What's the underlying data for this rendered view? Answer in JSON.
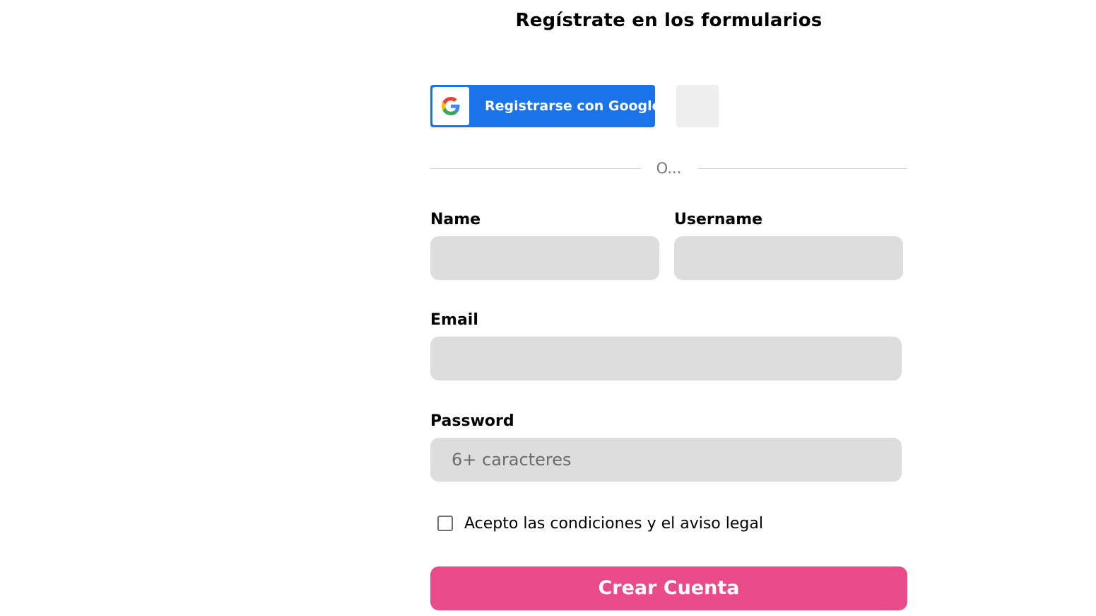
{
  "title": "Regístrate en los formularios",
  "social": {
    "google_label": "Registrarse con Google",
    "google_color": "#1a73e8",
    "google_icon": "google-g-icon"
  },
  "divider_text": "O...",
  "form": {
    "name_label": "Name",
    "name_value": "",
    "name_placeholder": "",
    "username_label": "Username",
    "username_value": "",
    "username_placeholder": "",
    "email_label": "Email",
    "email_value": "",
    "email_placeholder": "",
    "password_label": "Password",
    "password_value": "",
    "password_placeholder": "6+ caracteres",
    "terms_label": "Acepto las condiciones y el aviso legal",
    "terms_checked": false,
    "submit_label": "Crear Cuenta",
    "submit_color": "#e94a88"
  }
}
